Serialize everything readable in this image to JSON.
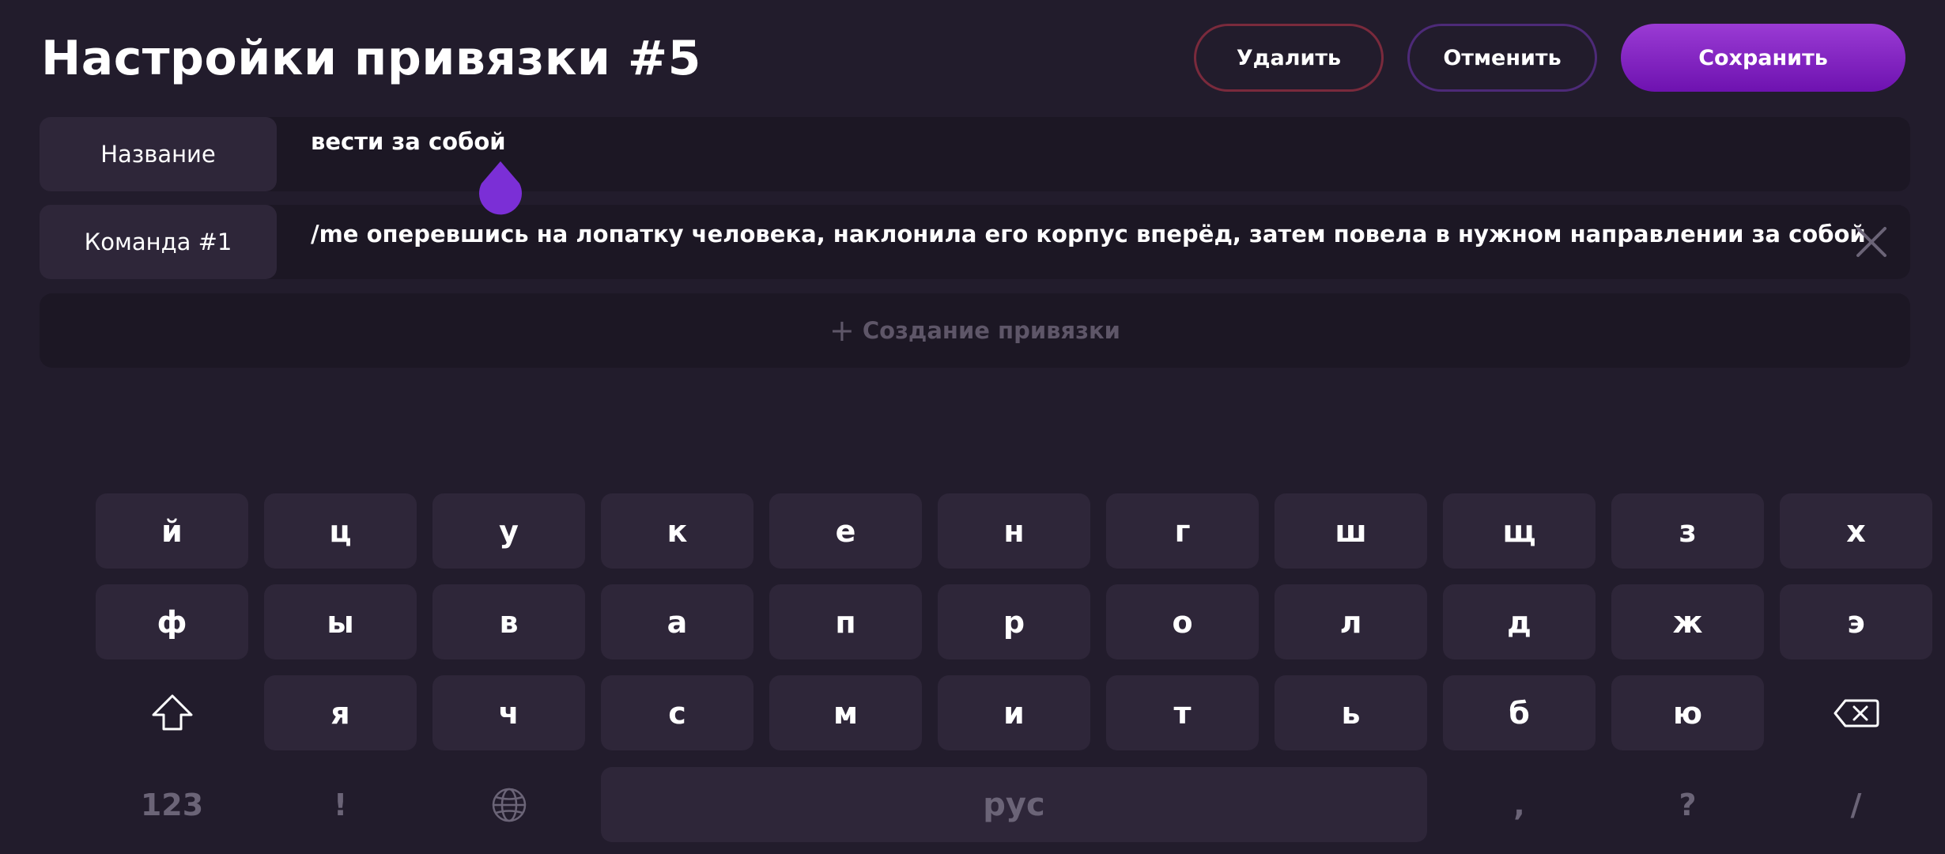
{
  "header": {
    "title": "Настройки привязки #5",
    "delete_label": "Удалить",
    "cancel_label": "Отменить",
    "save_label": "Сохранить"
  },
  "binding": {
    "name_label": "Название",
    "name_value": "вести за собой",
    "command_label": "Команда #1",
    "command_value": "/me оперевшись на лопатку человека, наклонила его корпус вперёд, затем повела в нужном направлении за собой",
    "create_label": "Создание привязки",
    "create_icon": "+"
  },
  "keyboard": {
    "row1": [
      "й",
      "ц",
      "у",
      "к",
      "е",
      "н",
      "г",
      "ш",
      "щ",
      "з",
      "х"
    ],
    "row2": [
      "ф",
      "ы",
      "в",
      "а",
      "п",
      "р",
      "о",
      "л",
      "д",
      "ж",
      "э"
    ],
    "row3": [
      "я",
      "ч",
      "с",
      "м",
      "и",
      "т",
      "ь",
      "б",
      "ю"
    ],
    "numbers_label": "123",
    "exclaim_label": "!",
    "space_label": "рус",
    "comma_label": ",",
    "question_label": "?",
    "slash_label": "/"
  },
  "colors": {
    "background": "#221c2c",
    "accent": "#8a2be2",
    "delete_border": "#7a2a3c",
    "cancel_border": "#4d2a78"
  }
}
